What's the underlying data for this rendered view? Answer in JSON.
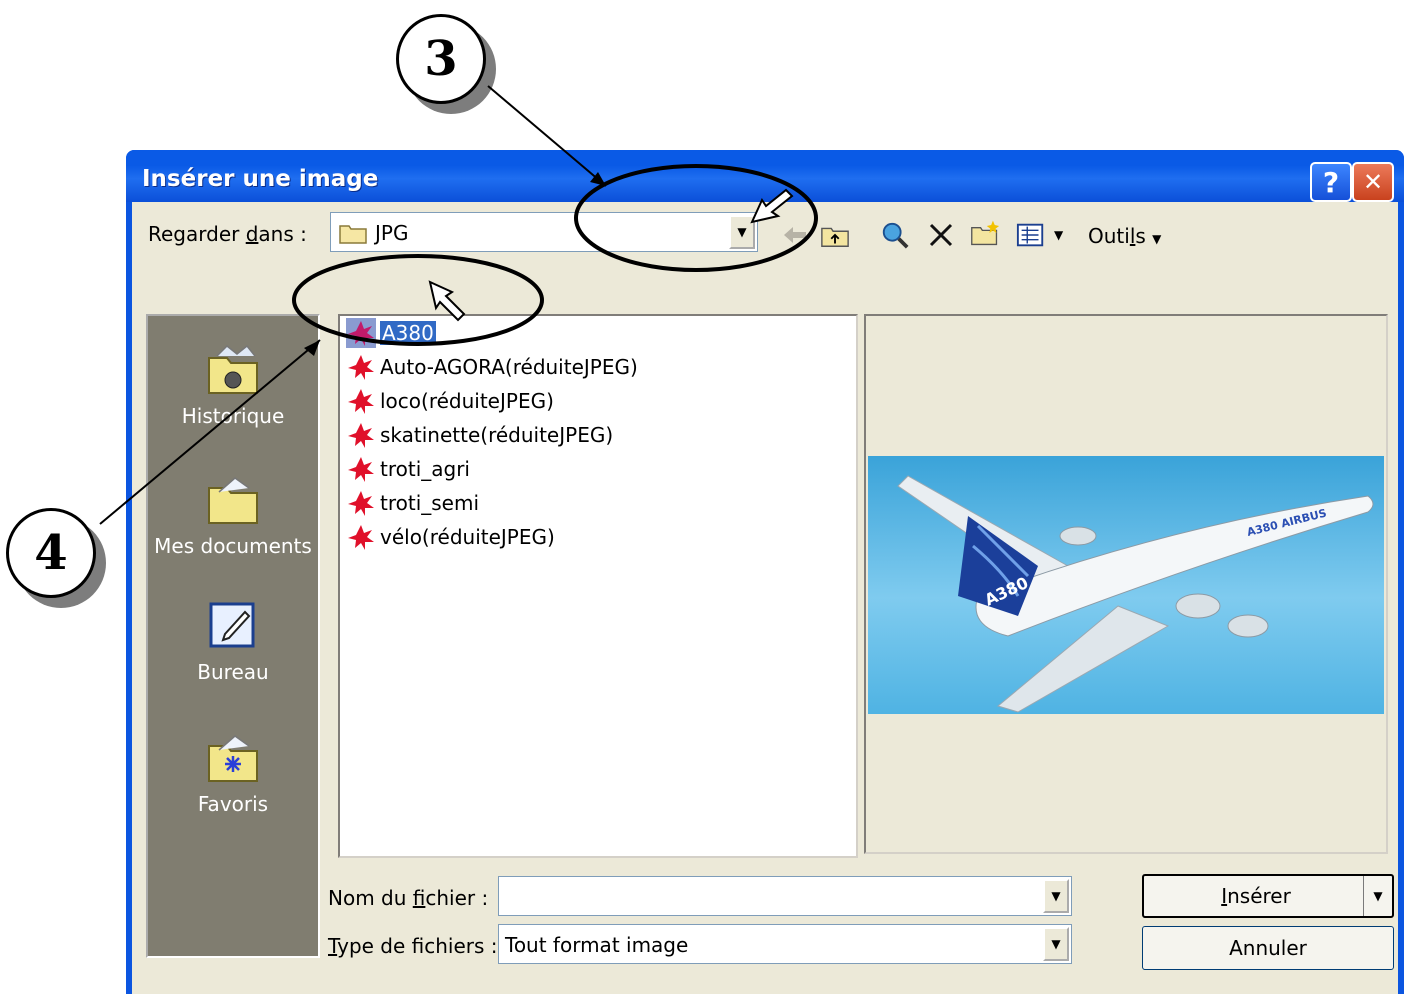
{
  "callouts": {
    "three": "3",
    "four": "4"
  },
  "dialog": {
    "title": "Insérer une image",
    "help_glyph": "?",
    "close_glyph": "✕",
    "look_in": {
      "label_pre": "Regarder ",
      "label_u": "d",
      "label_post": "ans :",
      "value": "JPG"
    },
    "toolbar": {
      "icons": [
        "back-icon",
        "up-folder-icon",
        "search-web-icon",
        "delete-icon",
        "new-folder-icon",
        "views-icon"
      ],
      "tools_pre": "Outi",
      "tools_u": "l",
      "tools_post": "s"
    },
    "places": [
      {
        "label": "Historique",
        "icon": "history-folder-icon"
      },
      {
        "label": "Mes documents",
        "icon": "my-documents-icon"
      },
      {
        "label": "Bureau",
        "icon": "desktop-icon"
      },
      {
        "label": "Favoris",
        "icon": "favorites-icon"
      }
    ],
    "files": [
      {
        "name": "A380",
        "selected": true
      },
      {
        "name": "Auto-AGORA(réduiteJPEG)"
      },
      {
        "name": "loco(réduiteJPEG)"
      },
      {
        "name": "skatinette(réduiteJPEG)"
      },
      {
        "name": "troti_agri"
      },
      {
        "name": "troti_semi"
      },
      {
        "name": "vélo(réduiteJPEG)"
      }
    ],
    "preview": {
      "plane_tail_text": "A380",
      "fuselage_text": "A380 AIRBUS"
    },
    "filename": {
      "label_pre": "Nom du ",
      "label_u": "f",
      "label_post": "ichier :",
      "value": ""
    },
    "filetype": {
      "label_u": "T",
      "label_post": "ype de fichiers :",
      "value": "Tout format image"
    },
    "insert_button": {
      "u": "I",
      "rest": "nsérer"
    },
    "cancel_button": "Annuler"
  }
}
